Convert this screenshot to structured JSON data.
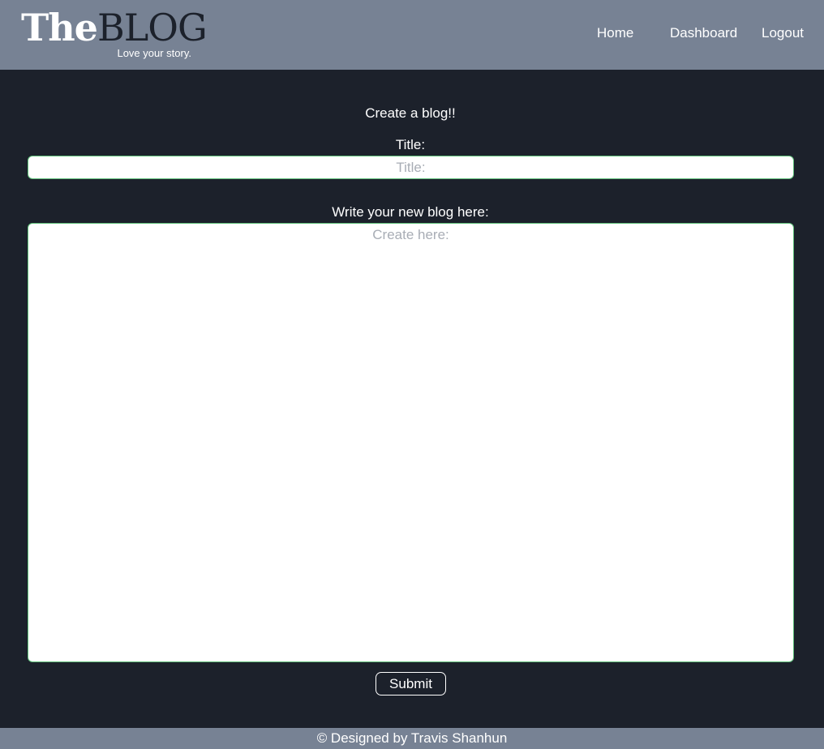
{
  "header": {
    "brand": {
      "the": "The",
      "blog": "BLOG",
      "tagline": "Love your story."
    },
    "nav": {
      "home": "Home",
      "dashboard": "Dashboard",
      "logout": "Logout"
    }
  },
  "form": {
    "heading": "Create a blog!!",
    "title_label": "Title:",
    "title_placeholder": "Title:",
    "title_value": "",
    "body_label": "Write your new blog here:",
    "body_placeholder": "Create here:",
    "body_value": "",
    "submit_label": "Submit"
  },
  "footer": {
    "text": "© Designed by Travis Shanhun"
  },
  "colors": {
    "header_bg": "#778294",
    "page_bg": "#1c212b",
    "field_border": "#5fbf7a"
  }
}
